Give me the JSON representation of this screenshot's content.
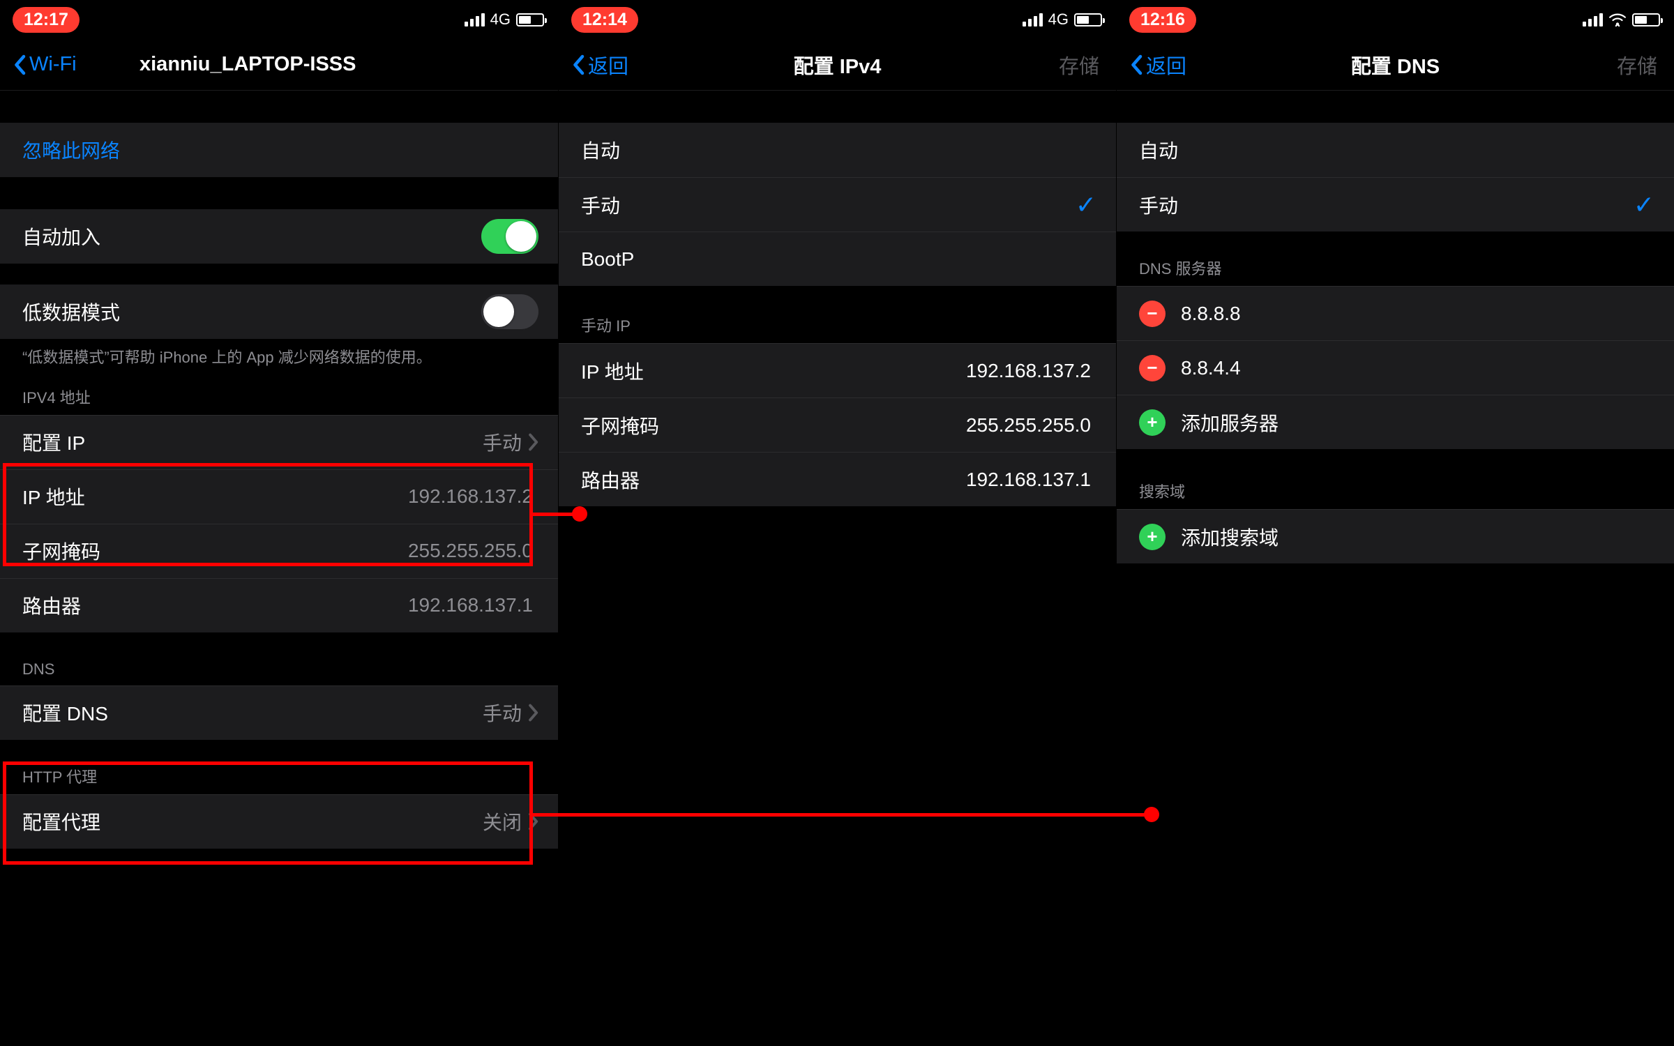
{
  "screens": {
    "wifi": {
      "time": "12:17",
      "net_label": "4G",
      "back_label": "Wi-Fi",
      "title": "xianniu_LAPTOP-ISSS",
      "forget": "忽略此网络",
      "auto_join": "自动加入",
      "low_data": "低数据模式",
      "low_data_note": "“低数据模式”可帮助 iPhone 上的 App 减少网络数据的使用。",
      "ipv4_header": "IPV4 地址",
      "configure_ip": "配置 IP",
      "configure_ip_value": "手动",
      "ip_label": "IP 地址",
      "ip_value": "192.168.137.2",
      "mask_label": "子网掩码",
      "mask_value": "255.255.255.0",
      "router_label": "路由器",
      "router_value": "192.168.137.1",
      "dns_header": "DNS",
      "configure_dns": "配置 DNS",
      "configure_dns_value": "手动",
      "proxy_header": "HTTP 代理",
      "configure_proxy": "配置代理",
      "configure_proxy_value": "关闭"
    },
    "ipv4": {
      "time": "12:14",
      "net_label": "4G",
      "back_label": "返回",
      "title": "配置 IPv4",
      "save": "存储",
      "opt_auto": "自动",
      "opt_manual": "手动",
      "opt_bootp": "BootP",
      "manual_header": "手动 IP",
      "ip_label": "IP 地址",
      "ip_value": "192.168.137.2",
      "mask_label": "子网掩码",
      "mask_value": "255.255.255.0",
      "router_label": "路由器",
      "router_value": "192.168.137.1"
    },
    "dns": {
      "time": "12:16",
      "back_label": "返回",
      "title": "配置 DNS",
      "save": "存储",
      "opt_auto": "自动",
      "opt_manual": "手动",
      "servers_header": "DNS 服务器",
      "server1": "8.8.8.8",
      "server2": "8.8.4.4",
      "add_server": "添加服务器",
      "search_header": "搜索域",
      "add_search": "添加搜索域"
    }
  }
}
